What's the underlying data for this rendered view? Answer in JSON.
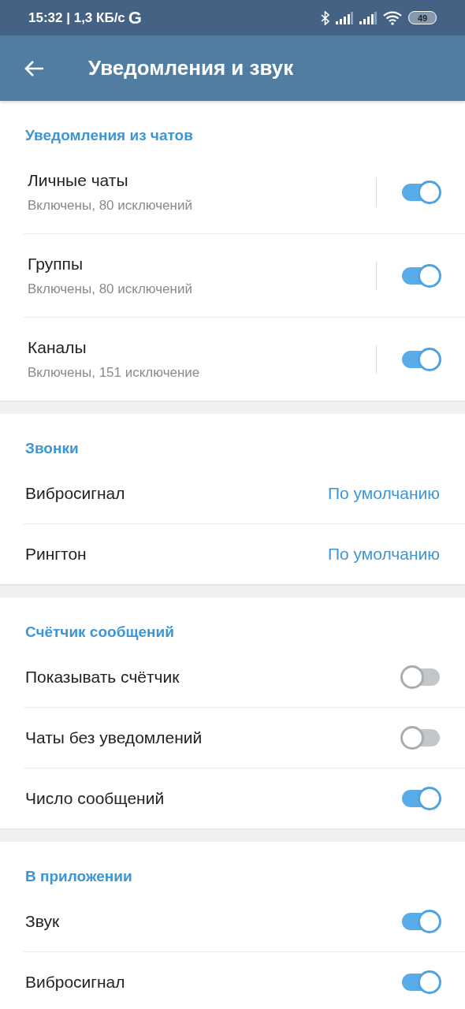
{
  "status_bar": {
    "time_speed": "15:32 | 1,3 КБ/с",
    "network": "G",
    "battery": "49"
  },
  "app_bar": {
    "title": "Уведомления и звук"
  },
  "sections": [
    {
      "header": "Уведомления из чатов",
      "rows": [
        {
          "kind": "split-toggle",
          "title": "Личные чаты",
          "subtitle": "Включены, 80 исключений",
          "on": true
        },
        {
          "kind": "split-toggle",
          "title": "Группы",
          "subtitle": "Включены, 80 исключений",
          "on": true
        },
        {
          "kind": "split-toggle",
          "title": "Каналы",
          "subtitle": "Включены, 151 исключение",
          "on": true
        }
      ]
    },
    {
      "header": "Звонки",
      "rows": [
        {
          "kind": "value",
          "title": "Вибросигнал",
          "value": "По умолчанию"
        },
        {
          "kind": "value",
          "title": "Рингтон",
          "value": "По умолчанию"
        }
      ]
    },
    {
      "header": "Счётчик сообщений",
      "rows": [
        {
          "kind": "toggle",
          "title": "Показывать счётчик",
          "on": false
        },
        {
          "kind": "toggle",
          "title": "Чаты без уведомлений",
          "on": false
        },
        {
          "kind": "toggle",
          "title": "Число сообщений",
          "on": true
        }
      ]
    },
    {
      "header": "В приложении",
      "rows": [
        {
          "kind": "toggle",
          "title": "Звук",
          "on": true
        },
        {
          "kind": "toggle",
          "title": "Вибросигнал",
          "on": true
        }
      ]
    }
  ]
}
